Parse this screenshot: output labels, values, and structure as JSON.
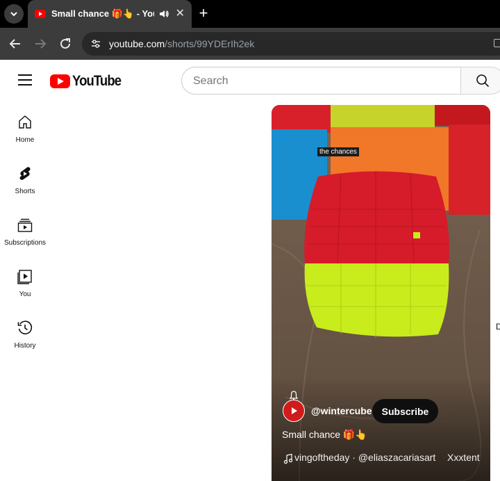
{
  "browser": {
    "tab_title": "Small chance 🎁👆 - YouTube",
    "address_host": "youtube.com",
    "address_path": "/shorts/99YDErIh2ek"
  },
  "header": {
    "logo_text": "YouTube",
    "search_placeholder": "Search"
  },
  "sidebar": {
    "items": [
      {
        "label": "Home",
        "icon": "home-icon"
      },
      {
        "label": "Shorts",
        "icon": "shorts-icon"
      },
      {
        "label": "Subscriptions",
        "icon": "subscriptions-icon"
      },
      {
        "label": "You",
        "icon": "you-icon"
      },
      {
        "label": "History",
        "icon": "history-icon"
      }
    ]
  },
  "short": {
    "caption": "the chances",
    "channel_handle": "@wintercube",
    "subscribe_label": "Subscribe",
    "title": "Small chance 🎁👆",
    "music_text": "vingoftheday · @eliaszacariasart",
    "music_author": "Xxxtent"
  },
  "edge_text": "D",
  "colors": {
    "brand_red": "#ff0000",
    "chrome_dark": "#3c3c3c",
    "subscribe_bg": "#0f0f0f"
  }
}
